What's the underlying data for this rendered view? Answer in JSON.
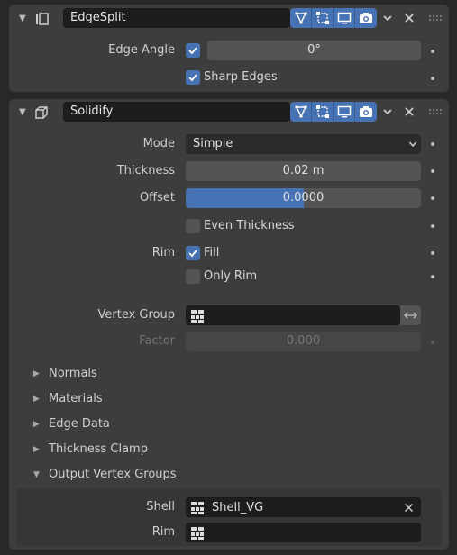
{
  "edgesplit": {
    "name": "EdgeSplit",
    "edge_angle_label": "Edge Angle",
    "edge_angle_value": "0°",
    "edge_angle_checked": true,
    "sharp_edges_label": "Sharp Edges",
    "sharp_edges_checked": true
  },
  "solidify": {
    "name": "Solidify",
    "mode_label": "Mode",
    "mode_value": "Simple",
    "thickness_label": "Thickness",
    "thickness_value": "0.02 m",
    "offset_label": "Offset",
    "offset_value": "0.0000",
    "offset_fraction": 0.5,
    "even_thickness_label": "Even Thickness",
    "even_thickness_checked": false,
    "rim_label": "Rim",
    "fill_label": "Fill",
    "fill_checked": true,
    "only_rim_label": "Only Rim",
    "only_rim_checked": false,
    "vertex_group_label": "Vertex Group",
    "vertex_group_value": "",
    "factor_label": "Factor",
    "factor_value": "0.000",
    "subpanels": [
      {
        "label": "Normals",
        "expanded": false
      },
      {
        "label": "Materials",
        "expanded": false
      },
      {
        "label": "Edge Data",
        "expanded": false
      },
      {
        "label": "Thickness Clamp",
        "expanded": false
      },
      {
        "label": "Output Vertex Groups",
        "expanded": true
      }
    ],
    "shell_label": "Shell",
    "shell_value": "Shell_VG",
    "rim_vg_label": "Rim",
    "rim_vg_value": ""
  },
  "colors": {
    "accent": "#4772b3",
    "panel": "#3d3d3d",
    "background": "#282828"
  }
}
